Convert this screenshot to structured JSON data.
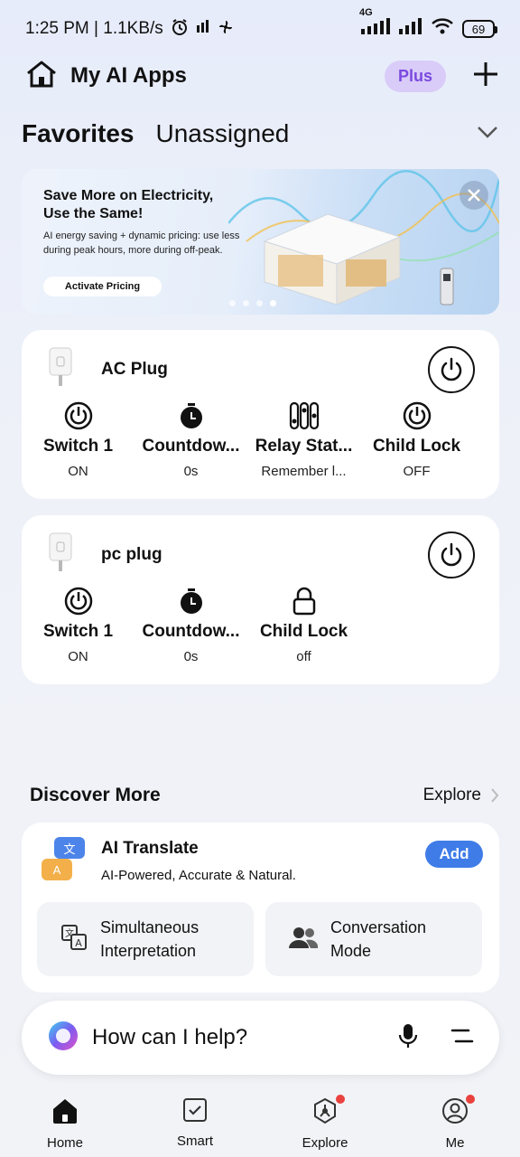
{
  "status": {
    "time_speed": "1:25 PM | 1.1KB/s",
    "network_label": "4G",
    "battery": "69"
  },
  "header": {
    "title": "My AI Apps",
    "plus_label": "Plus"
  },
  "tabs": [
    {
      "label": "Favorites",
      "active": true
    },
    {
      "label": "Unassigned",
      "active": false
    }
  ],
  "banner": {
    "title_line1": "Save More on Electricity,",
    "title_line2": "Use the Same!",
    "description": "AI energy saving + dynamic pricing: use less during peak hours, more during off-peak.",
    "button": "Activate Pricing",
    "page_count": 4,
    "active_page": 4
  },
  "devices": [
    {
      "name": "AC Plug",
      "functions": [
        {
          "icon": "power-icon",
          "label": "Switch 1",
          "value": "ON"
        },
        {
          "icon": "timer-icon",
          "label": "Countdow...",
          "value": "0s"
        },
        {
          "icon": "relay-icon",
          "label": "Relay Stat...",
          "value": "Remember l..."
        },
        {
          "icon": "power-icon",
          "label": "Child Lock",
          "value": "OFF"
        }
      ]
    },
    {
      "name": "pc plug",
      "functions": [
        {
          "icon": "power-icon",
          "label": "Switch 1",
          "value": "ON"
        },
        {
          "icon": "timer-icon",
          "label": "Countdow...",
          "value": "0s"
        },
        {
          "icon": "lock-icon",
          "label": "Child Lock",
          "value": "off"
        }
      ]
    }
  ],
  "discover": {
    "title": "Discover More",
    "explore": "Explore"
  },
  "translate": {
    "icon_glyph_1": "文",
    "icon_glyph_2": "A",
    "title": "AI Translate",
    "subtitle": "AI-Powered, Accurate & Natural.",
    "add": "Add",
    "modes": [
      {
        "line1": "Simultaneous",
        "line2": "Interpretation",
        "icon": "translate-icon"
      },
      {
        "line1": "Conversation",
        "line2": "Mode",
        "icon": "people-icon"
      }
    ]
  },
  "assistant": {
    "prompt": "How can I help?"
  },
  "nav": [
    {
      "label": "Home",
      "icon": "home-icon",
      "badge": false
    },
    {
      "label": "Smart",
      "icon": "checkbox-icon",
      "badge": false
    },
    {
      "label": "Explore",
      "icon": "explore-icon",
      "badge": true
    },
    {
      "label": "Me",
      "icon": "profile-icon",
      "badge": true
    }
  ],
  "colors": {
    "accent": "#3f7ce8",
    "plus_bg": "#d9ccf8",
    "plus_text": "#7b4ae0",
    "badge": "#e9423e"
  }
}
